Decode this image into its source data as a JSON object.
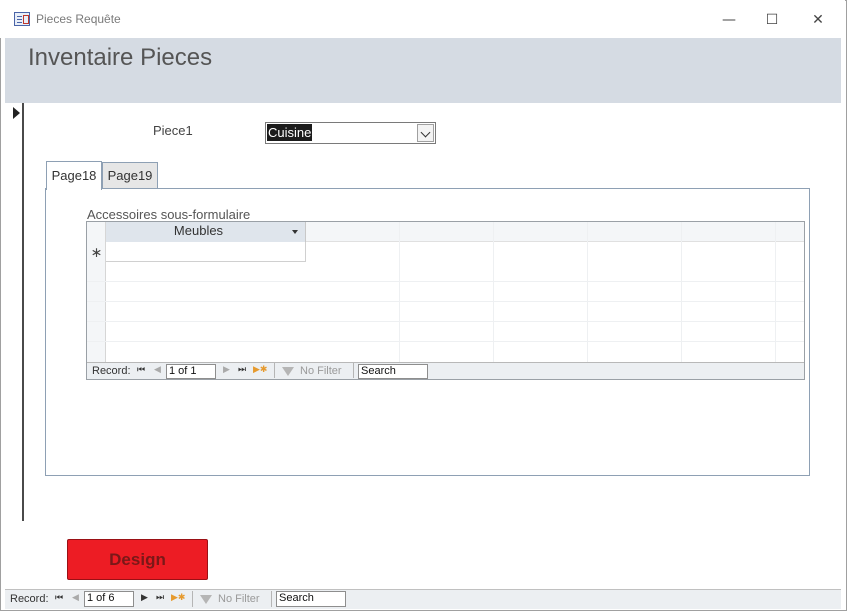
{
  "window": {
    "title": "Pieces Requête",
    "minimize": "—",
    "maximize": "☐",
    "close": "✕"
  },
  "header": {
    "title": "Inventaire Pieces"
  },
  "piece_field": {
    "label": "Piece1",
    "value": "Cuisine"
  },
  "tabs": [
    {
      "label": "Page18",
      "active": true
    },
    {
      "label": "Page19",
      "active": false
    }
  ],
  "subform": {
    "label": "Accessoires sous-formulaire",
    "columns": [
      {
        "header": "Meubles"
      }
    ],
    "new_row_marker": "∗",
    "nav": {
      "record_label": "Record:",
      "position": "1 of 1",
      "filter_label": "No Filter",
      "search_label": "Search"
    }
  },
  "main_nav": {
    "record_label": "Record:",
    "position": "1 of 6",
    "filter_label": "No Filter",
    "search_label": "Search"
  },
  "design_button": {
    "label": "Design",
    "color": "#ed1c24"
  }
}
